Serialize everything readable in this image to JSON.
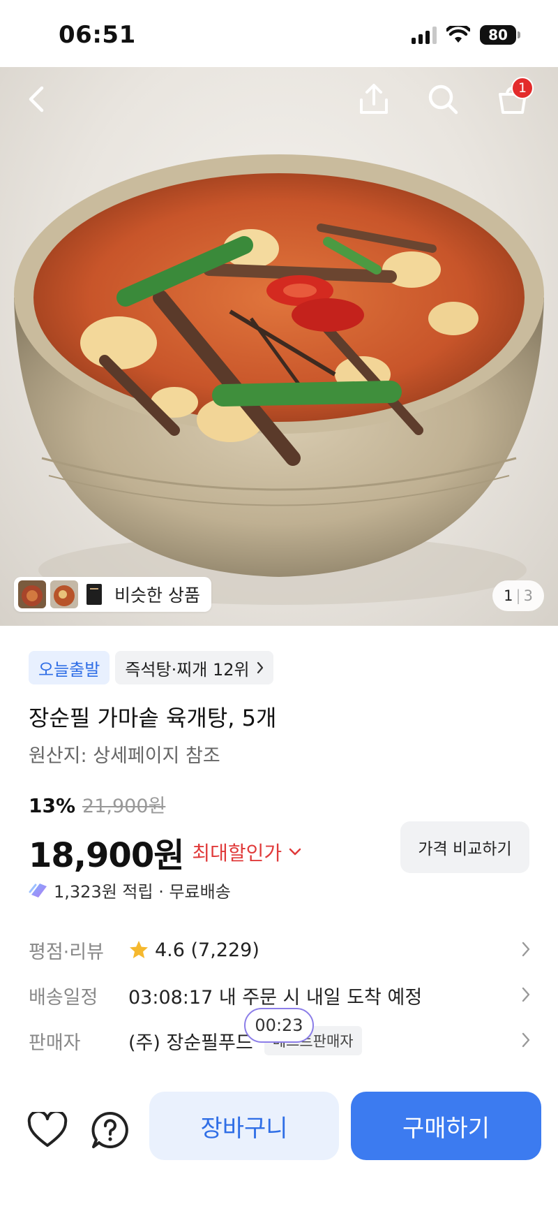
{
  "status_bar": {
    "time": "06:51",
    "battery": "80"
  },
  "hero": {
    "cart_badge_count": "1",
    "similar_label": "비슷한 상품",
    "page_current": "1",
    "page_separator": "|",
    "page_total": "3"
  },
  "product": {
    "badge_today": "오늘출발",
    "badge_rank": "즉석탕·찌개 12위",
    "title": "장순필 가마솥 육개탕, 5개",
    "origin": "원산지: 상세페이지 참조",
    "discount_rate": "13%",
    "original_price": "21,900원",
    "price": "18,900원",
    "max_discount_label": "최대할인가",
    "compare_button": "가격 비교하기",
    "points_text": "1,323원 적립 · 무료배송"
  },
  "details": {
    "rating_label": "평점·리뷰",
    "rating_value": "4.6 (7,229)",
    "delivery_label": "배송일정",
    "delivery_value": "03:08:17 내 주문 시 내일 도착 예정",
    "seller_label": "판매자",
    "seller_value": "(주) 장순필푸드",
    "seller_tag": "베스트판매자"
  },
  "timer": "00:23",
  "bottom_bar": {
    "cart_button": "장바구니",
    "buy_button": "구매하기"
  },
  "colors": {
    "accent": "#3c7bf0",
    "accent_light": "#eaf1fd",
    "discount_red": "#e03a3a",
    "badge_red": "#e32b2b",
    "star": "#f5b82e"
  },
  "icons": [
    "back-icon",
    "share-icon",
    "search-icon",
    "cart-icon",
    "chevron-right-icon",
    "chevron-down-icon",
    "star-icon",
    "points-icon",
    "heart-icon",
    "question-icon"
  ]
}
